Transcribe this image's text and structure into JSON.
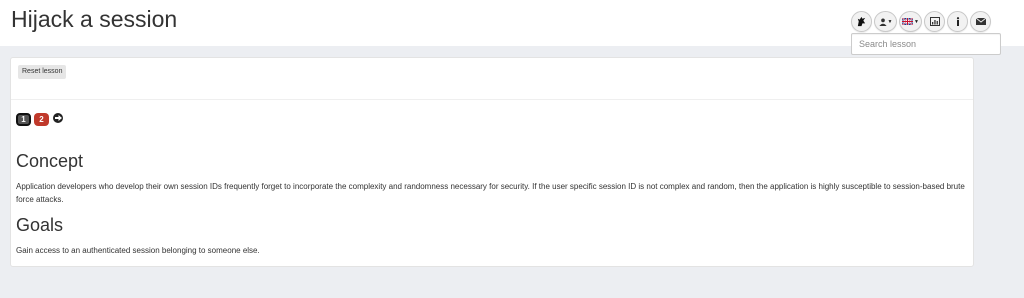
{
  "header": {
    "title": "Hijack a session",
    "toolbar": [
      {
        "name": "wolf-icon"
      },
      {
        "name": "user-menu-icon"
      },
      {
        "name": "language-flag-icon"
      },
      {
        "name": "report-card-icon"
      },
      {
        "name": "info-icon"
      },
      {
        "name": "mail-icon"
      }
    ],
    "search": {
      "placeholder": "Search lesson",
      "value": ""
    }
  },
  "lesson": {
    "reset_label": "Reset lesson",
    "pages": [
      {
        "label": "1",
        "state": "active"
      },
      {
        "label": "2",
        "state": "incomplete"
      }
    ],
    "concept_heading": "Concept",
    "concept_text": "Application developers who develop their own session IDs frequently forget to incorporate the complexity and randomness necessary for security. If the user specific session ID is not complex and random, then the application is highly susceptible to session-based brute force attacks.",
    "goals_heading": "Goals",
    "goals_text": "Gain access to an authenticated session belonging to someone else."
  },
  "colors": {
    "page_bg": "#eceef2",
    "incomplete_badge": "#c0392b",
    "active_badge": "#555555"
  }
}
